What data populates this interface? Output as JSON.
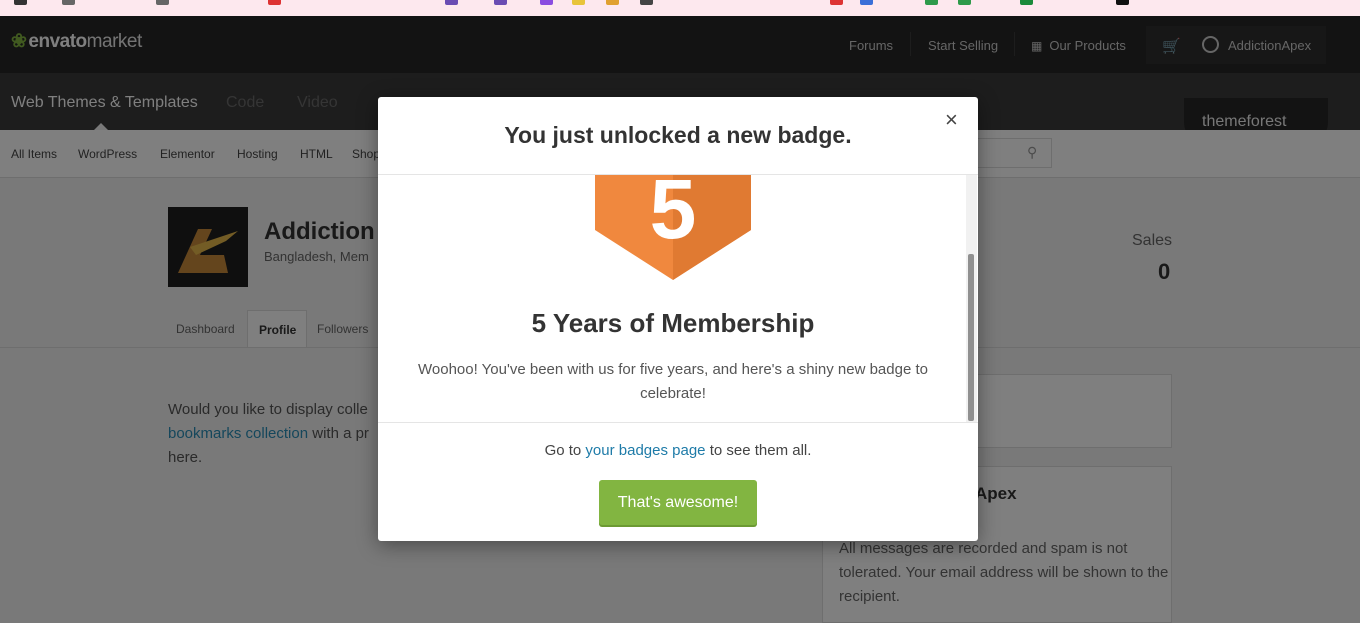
{
  "header": {
    "logo_brand": "envato",
    "logo_suffix": "market",
    "nav": [
      "Forums",
      "Start Selling",
      "Our Products"
    ],
    "username": "AddictionApex"
  },
  "categories": {
    "items": [
      "Web Themes & Templates",
      "Code",
      "Video"
    ],
    "site_badge": "themeforest"
  },
  "subnav": {
    "items": [
      "All Items",
      "WordPress",
      "Elementor",
      "Hosting",
      "HTML",
      "Shop"
    ]
  },
  "profile": {
    "name": "Addiction",
    "location": "Bangladesh, Mem",
    "sales_label": "Sales",
    "sales_value": "0",
    "tabs": [
      "Dashboard",
      "Profile",
      "Followers"
    ]
  },
  "content": {
    "para_line1": "Would you like to display colle",
    "para_link": "bookmarks collection",
    "para_line2": " with a pr",
    "para_line3": "here.",
    "panel_title": "Apex",
    "panel_text": "All messages are recorded and spam is not tolerated. Your email address will be shown to the recipient."
  },
  "modal": {
    "title": "You just unlocked a new badge.",
    "close": "×",
    "badge_number": "5",
    "badge_title": "5 Years of Membership",
    "badge_desc": "Woohoo! You've been with us for five years, and here's a shiny new badge to celebrate!",
    "footer_prefix": "Go to ",
    "footer_link": "your badges page",
    "footer_suffix": " to see them all.",
    "button": "That's awesome!"
  },
  "colors": {
    "accent_green": "#82b541",
    "badge_orange": "#f0883e",
    "link_blue": "#1e7ba8"
  }
}
